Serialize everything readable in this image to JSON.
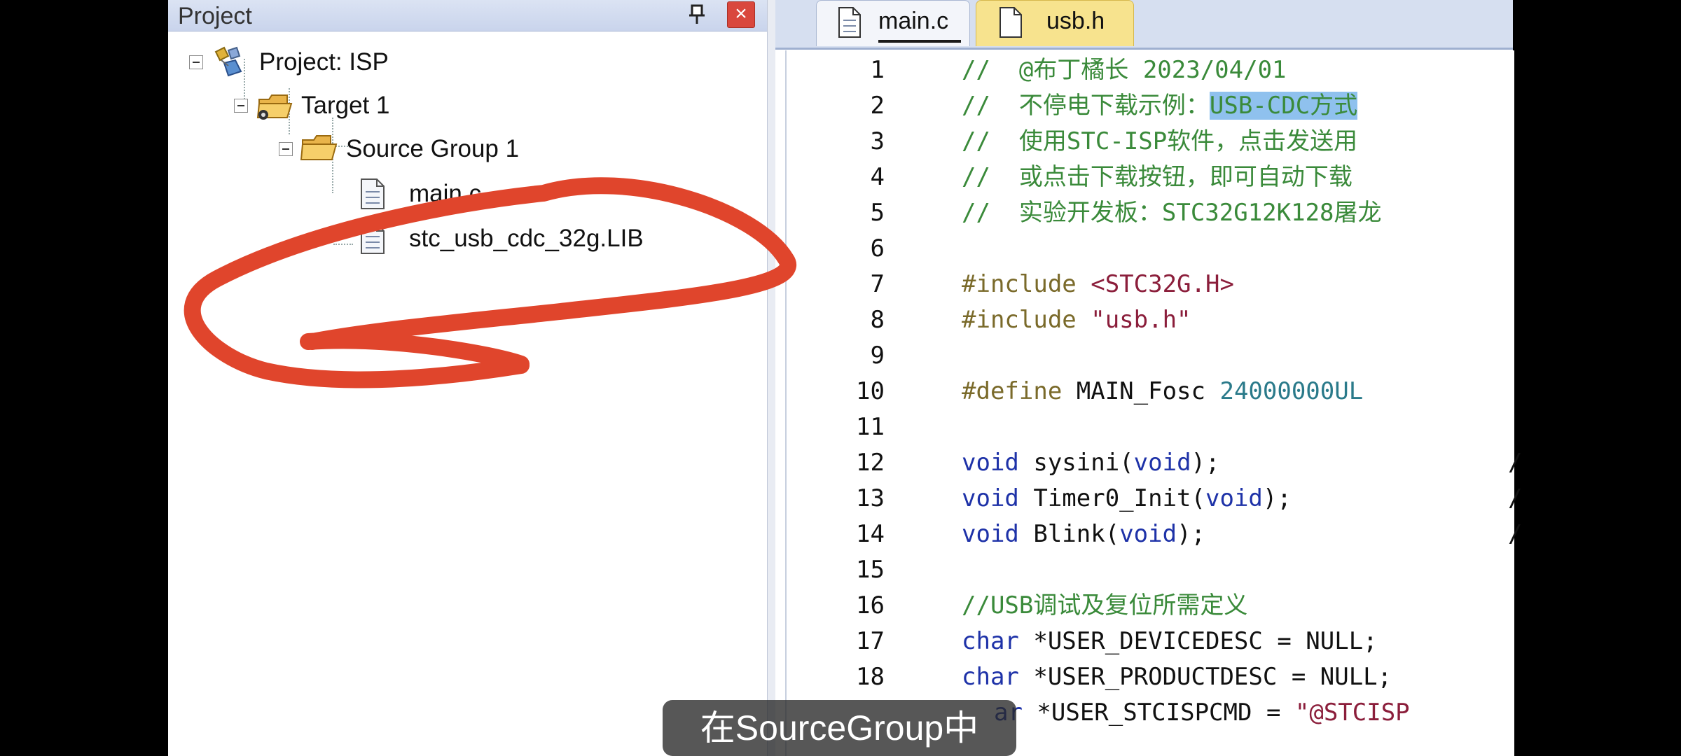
{
  "project_panel": {
    "title": "Project",
    "close_symbol": "×",
    "tree": [
      {
        "label": "Project: ISP",
        "icon": "project-icon",
        "level": 0
      },
      {
        "label": "Target 1",
        "icon": "target-folder-icon",
        "level": 1
      },
      {
        "label": "Source Group 1",
        "icon": "folder-icon",
        "level": 2
      },
      {
        "label": "main.c",
        "icon": "file-icon",
        "level": 3
      },
      {
        "label": "stc_usb_cdc_32g.LIB",
        "icon": "file-icon",
        "level": 3
      }
    ]
  },
  "editor": {
    "tabs": [
      {
        "label": "main.c",
        "active": true
      },
      {
        "label": "usb.h",
        "active": false
      }
    ],
    "lines": [
      {
        "n": "1"
      },
      {
        "n": "2"
      },
      {
        "n": "3"
      },
      {
        "n": "4"
      },
      {
        "n": "5"
      },
      {
        "n": "6"
      },
      {
        "n": "7"
      },
      {
        "n": "8"
      },
      {
        "n": "9"
      },
      {
        "n": "10"
      },
      {
        "n": "11"
      },
      {
        "n": "12"
      },
      {
        "n": "13"
      },
      {
        "n": "14"
      },
      {
        "n": "15"
      },
      {
        "n": "16"
      },
      {
        "n": "17"
      },
      {
        "n": "18"
      }
    ],
    "code": {
      "l1": "//  @布丁橘长 2023/04/01",
      "l2a": "//  不停电下载示例：",
      "l2b": "USB-CDC方式",
      "l3": "//  使用STC-ISP软件，点击发送用",
      "l4": "//  或点击下载按钮，即可自动下载",
      "l5": "//  实验开发板：STC32G12K128屠龙",
      "l7a": "#include ",
      "l7b": "<STC32G.H>",
      "l8a": "#include ",
      "l8b": "\"usb.h\"",
      "l10a": "#define ",
      "l10b": "MAIN_Fosc ",
      "l10c": "24000000UL",
      "l12a": "void",
      "l12b": " sysini(",
      "l12c": "void",
      "l12d": ");",
      "l13a": "void",
      "l13b": " Timer0_Init(",
      "l13c": "void",
      "l13d": ");",
      "l14a": "void",
      "l14b": " Blink(",
      "l14c": "void",
      "l14d": ");",
      "l16": "//USB调试及复位所需定义",
      "l17a": "char",
      "l17b": " *USER_DEVICEDESC = NULL;",
      "l18a": "char",
      "l18b": " *USER_PRODUCTDESC = NULL;",
      "l19a": "ar",
      "l19b": " *USER_STCISPCMD = ",
      "l19c": "\"@STCISP",
      "trailing_slash": "/"
    }
  },
  "subtitle": "在SourceGroup中",
  "colors": {
    "annotation": "#e0452c",
    "selection": "#8fc1ee",
    "active_tab_underline": "#1a1a1a"
  }
}
